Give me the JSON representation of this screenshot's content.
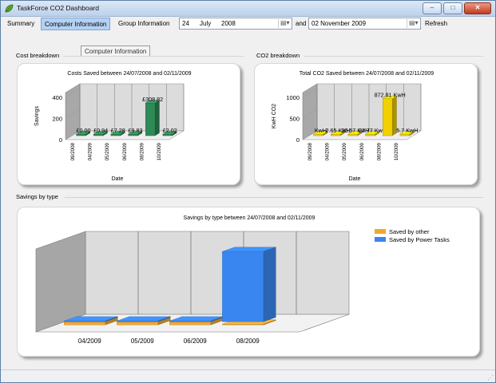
{
  "window": {
    "title": "TaskForce CO2 Dashboard"
  },
  "menu": [
    {
      "label": "Summary"
    },
    {
      "label": "Computer Information"
    },
    {
      "label": "Group Information"
    }
  ],
  "date_from": {
    "day": "24",
    "month": "July",
    "year": "2008"
  },
  "and_label": "and",
  "date_to": {
    "value": "02 November 2009"
  },
  "refresh_label": "Refresh",
  "tooltip": "Computer Information",
  "groups": {
    "cost": "Cost breakdown",
    "co2": "CO2 breakdown",
    "savings": "Savings by type"
  },
  "icons": {
    "app": "leaf-icon",
    "dropdown": "calendar-dropdown-icon"
  },
  "chart_data": [
    {
      "type": "bar",
      "title": "Costs Saved between 24/07/2008 and 02/11/2009",
      "xlabel": "Date",
      "ylabel": "Savings",
      "ylim": [
        0,
        400
      ],
      "yticks": [
        "400",
        "200",
        "0"
      ],
      "categories": [
        "09/2008",
        "04/2009",
        "05/2009",
        "06/2009",
        "08/2009",
        "10/2009"
      ],
      "values": [
        0.0,
        0.94,
        7.28,
        9.83,
        308.82,
        2.02
      ],
      "data_labels": [
        "£0.00",
        "£0.94",
        "£7.28",
        "£9.83",
        "£308.82",
        "£2.02"
      ],
      "color": "#2e8b57",
      "grid": true
    },
    {
      "type": "bar",
      "title": "Total CO2 Saved between 24/07/2008 and 02/11/2009",
      "xlabel": "Date",
      "ylabel": "KwH CO2",
      "ylim": [
        0,
        1000
      ],
      "yticks": [
        "1000",
        "500",
        "0"
      ],
      "categories": [
        "09/2008",
        "04/2009",
        "05/2009",
        "06/2009",
        "08/2009",
        "10/2009"
      ],
      "values": [
        0,
        2.65,
        20.57,
        27.77,
        872.81,
        5.7
      ],
      "data_labels": [
        "KwH",
        "2.65 KwH",
        "20.57 KwH",
        "27.77 KwH",
        "872.81 KwH",
        "5.7 KwH"
      ],
      "color": "#f2d000",
      "grid": true
    },
    {
      "type": "bar",
      "title": "Savings by type between 24/07/2008 and 02/11/2009",
      "categories": [
        "04/2009",
        "05/2009",
        "06/2009",
        "08/2009"
      ],
      "series": [
        {
          "name": "Saved by other",
          "values": [
            0.94,
            7.28,
            9.83,
            0
          ],
          "color": "#f0a830"
        },
        {
          "name": "Saved by Power Tasks",
          "values": [
            0,
            0,
            0,
            308.82
          ],
          "color": "#3a86f0"
        }
      ],
      "legend": "top-right",
      "grid": true
    }
  ]
}
